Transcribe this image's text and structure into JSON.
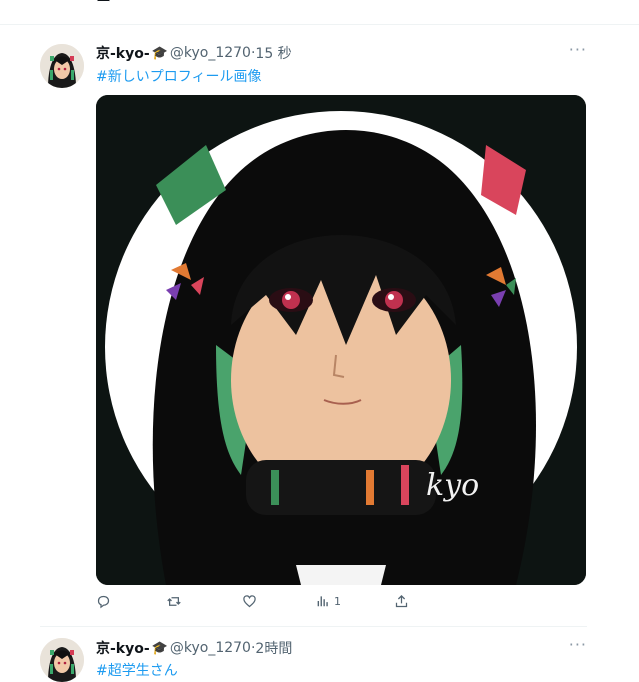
{
  "tweets": [
    {
      "display_name": "京-kyo-",
      "badge_icon": "graduation-cap-icon",
      "handle": "@kyo_1270",
      "separator": "·",
      "time": "15 秒",
      "text": "#新しいプロフィール画像",
      "image_signature": "kyo",
      "actions": {
        "reply_icon": "reply-icon",
        "retweet_icon": "retweet-icon",
        "like_icon": "heart-icon",
        "views_icon": "analytics-icon",
        "views_count": "1",
        "share_icon": "share-icon"
      }
    },
    {
      "display_name": "京-kyo-",
      "badge_icon": "graduation-cap-icon",
      "handle": "@kyo_1270",
      "separator": "·",
      "time": "2時間",
      "text": "#超学生さん"
    }
  ],
  "colors": {
    "link": "#1d9bf0",
    "secondary_text": "#536471",
    "divider": "#eff3f4",
    "image_background": "#0d1412"
  }
}
